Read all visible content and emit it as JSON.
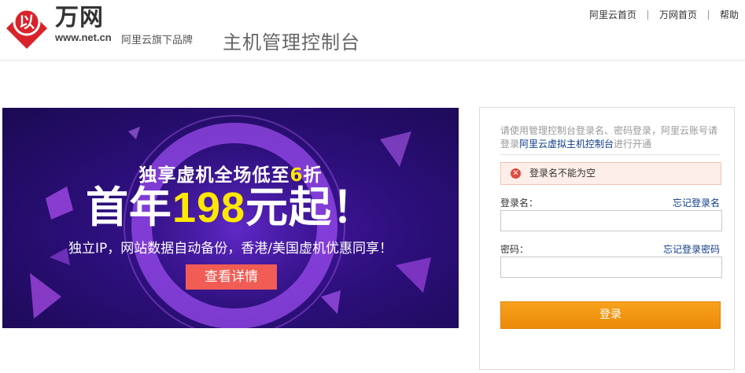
{
  "header": {
    "brand_name": "万网",
    "brand_url": "www.net.cn",
    "brand_sub": "阿里云旗下品牌",
    "page_title": "主机管理控制台",
    "nav": [
      "阿里云首页",
      "万网首页",
      "帮助"
    ],
    "logo_mark": "以",
    "colors": {
      "logo_red": "#d8232a"
    }
  },
  "banner": {
    "line1_prefix": "独享虚机全场低至",
    "line1_highlight": "6",
    "line1_suffix": "折",
    "line2_prefix": "首年",
    "line2_highlight": "198",
    "line2_suffix": "元起！",
    "line3": "独立IP，网站数据自动备份，香港/美国虚机优惠同享！",
    "button_label": "查看详情",
    "colors": {
      "highlight": "#ffe800",
      "button": "#f15d55"
    }
  },
  "login": {
    "tip_prefix": "请使用管理控制台登录名、密码登录，阿里云账号请登录",
    "tip_link": "阿里云虚拟主机控制台",
    "tip_suffix": "进行开通",
    "error_message": "登录名不能为空",
    "username_label": "登录名：",
    "username_forgot": "忘记登录名",
    "username_value": "",
    "password_label": "密码：",
    "password_forgot": "忘记登录密码",
    "password_value": "",
    "submit_label": "登录",
    "colors": {
      "button": "#f29614",
      "link": "#0e3c8c",
      "error_bg": "#fdeee9"
    }
  }
}
